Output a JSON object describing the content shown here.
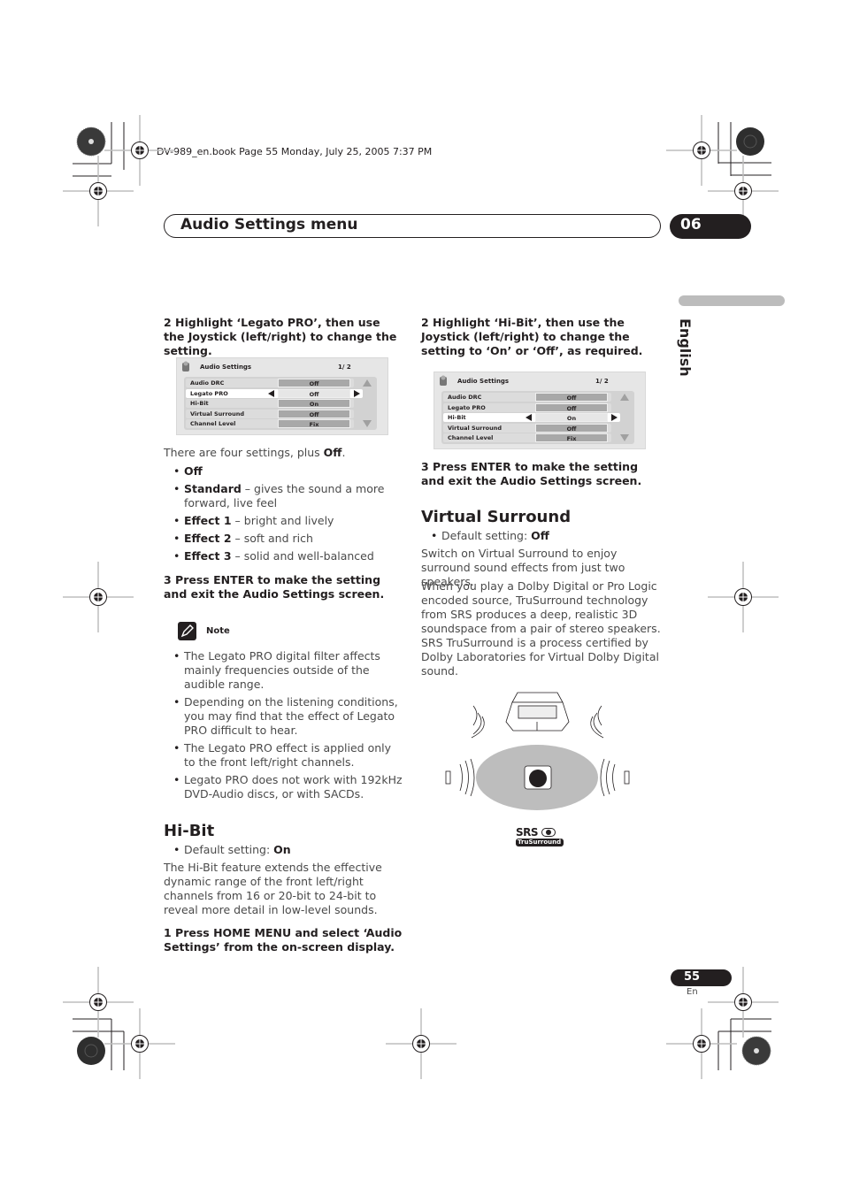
{
  "print_header": "DV-989_en.book  Page 55  Monday, July 25, 2005  7:37 PM",
  "section_title": "Audio Settings menu",
  "chapter_number": "06",
  "language_tab": "English",
  "left_column": {
    "step2": "2    Highlight ‘Legato PRO’, then use the Joystick (left/right) to change the setting.",
    "osd": {
      "title": "Audio Settings",
      "page": "1/  2",
      "rows": [
        {
          "label": "Audio DRC",
          "value": "Off"
        },
        {
          "label": "Legato PRO",
          "value": "Off"
        },
        {
          "label": "Hi-Bit",
          "value": "On"
        },
        {
          "label": "Virtual Surround",
          "value": "Off"
        },
        {
          "label": "Channel Level",
          "value": "Fix"
        }
      ],
      "selected_index": 1
    },
    "settings_intro_prefix": "There are four settings, plus ",
    "settings_intro_bold": "Off",
    "settings_intro_suffix": ".",
    "settings": [
      {
        "name": "Off",
        "desc": ""
      },
      {
        "name": "Standard",
        "desc": " – gives the sound a more forward, live feel"
      },
      {
        "name": "Effect 1",
        "desc": " – bright and lively"
      },
      {
        "name": "Effect 2",
        "desc": " – soft and rich"
      },
      {
        "name": "Effect 3",
        "desc": " – solid and well-balanced"
      }
    ],
    "step3": "3    Press ENTER to make the setting and exit the Audio Settings screen.",
    "note_label": "Note",
    "notes": [
      "The Legato PRO digital filter affects mainly frequencies outside of the audible range.",
      "Depending on the listening conditions, you may find that the effect of Legato PRO difficult to hear.",
      "The Legato PRO effect is applied only to the front left/right channels.",
      "Legato PRO does not work with 192kHz DVD-Audio discs, or with SACDs."
    ],
    "hibit_heading": "Hi-Bit",
    "hibit_default_prefix": "Default setting: ",
    "hibit_default_value": "On",
    "hibit_body": "The Hi-Bit feature extends the effective dynamic range of the front left/right channels from 16 or 20-bit to 24-bit to reveal more detail in low-level sounds.",
    "hibit_step1": "1    Press HOME MENU and select ‘Audio Settings’ from the on-screen display."
  },
  "right_column": {
    "step2": "2    Highlight ‘Hi-Bit’, then use the Joystick (left/right) to change the setting to ‘On’ or ‘Off’, as required.",
    "osd": {
      "title": "Audio Settings",
      "page": "1/  2",
      "rows": [
        {
          "label": "Audio DRC",
          "value": "Off"
        },
        {
          "label": "Legato PRO",
          "value": "Off"
        },
        {
          "label": "Hi-Bit",
          "value": "On"
        },
        {
          "label": "Virtual Surround",
          "value": "Off"
        },
        {
          "label": "Channel Level",
          "value": "Fix"
        }
      ],
      "selected_index": 2
    },
    "step3": "3    Press ENTER to make the setting and exit the Audio Settings screen.",
    "vs_heading": "Virtual Surround",
    "vs_default_prefix": "Default setting: ",
    "vs_default_value": "Off",
    "vs_para1": "Switch on Virtual Surround to enjoy surround sound effects from just two speakers.",
    "vs_para2": "When you play a Dolby Digital or Pro Logic encoded source, TruSurround technology from SRS produces a deep, realistic 3D soundspace from a pair of stereo speakers. SRS TruSurround is a process certified by Dolby Laboratories for Virtual Dolby Digital sound.",
    "logo_top": "SRS",
    "logo_bottom": "TruSurround"
  },
  "page_number": "55",
  "page_lang": "En"
}
